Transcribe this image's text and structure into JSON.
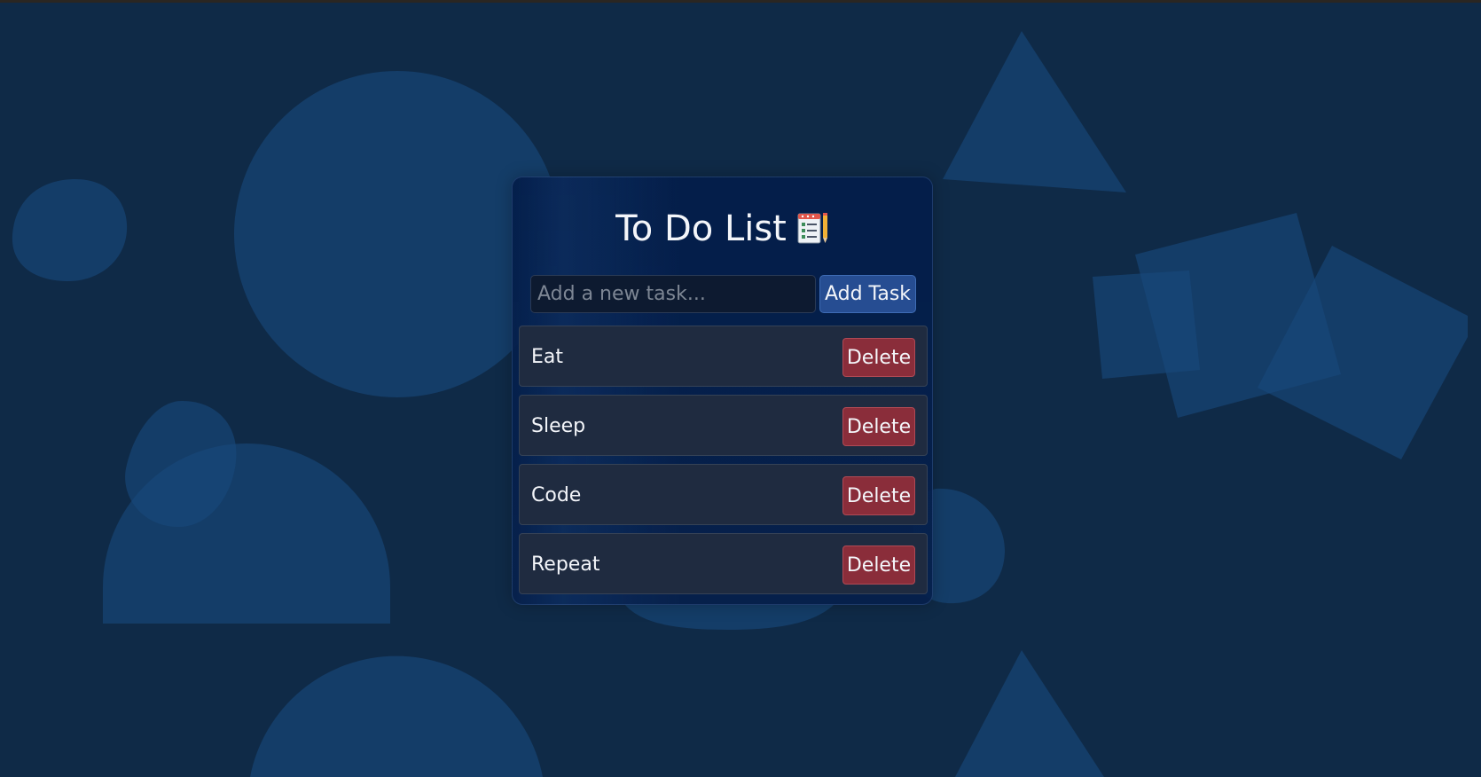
{
  "app": {
    "title": "To Do List",
    "title_icon": "notepad-checklist-icon"
  },
  "input": {
    "placeholder": "Add a new task...",
    "value": ""
  },
  "buttons": {
    "add_label": "Add Task",
    "delete_label": "Delete"
  },
  "tasks": [
    {
      "text": "Eat"
    },
    {
      "text": "Sleep"
    },
    {
      "text": "Code"
    },
    {
      "text": "Repeat"
    }
  ],
  "colors": {
    "background": "#0f2a47",
    "shape": "#19497d",
    "card": "#061f4c",
    "add_button": "#264d92",
    "delete_button": "#8a2d3a",
    "task_row": "#1f2b40"
  }
}
